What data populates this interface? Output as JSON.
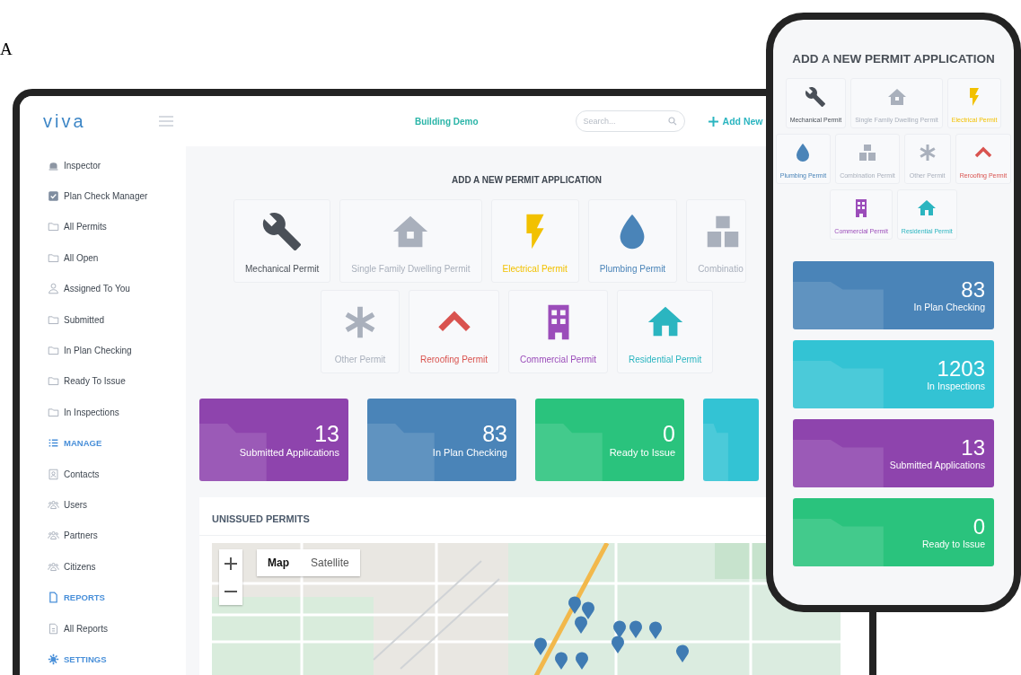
{
  "caption": "A",
  "tablet": {
    "logo": "viva",
    "header_title": "Building Demo",
    "search": {
      "placeholder": "Search..."
    },
    "add_button": "Add New",
    "sidebar": [
      {
        "kind": "inspector",
        "label": "Inspector"
      },
      {
        "kind": "check",
        "label": "Plan Check Manager"
      },
      {
        "kind": "folder",
        "label": "All Permits"
      },
      {
        "kind": "folder",
        "label": "All Open"
      },
      {
        "kind": "person",
        "label": "Assigned To You"
      },
      {
        "kind": "folder",
        "label": "Submitted"
      },
      {
        "kind": "folder",
        "label": "In Plan Checking"
      },
      {
        "kind": "folder",
        "label": "Ready To Issue"
      },
      {
        "kind": "folder",
        "label": "In Inspections"
      },
      {
        "kind": "list-heading",
        "label": "MANAGE"
      },
      {
        "kind": "contact",
        "label": "Contacts"
      },
      {
        "kind": "group",
        "label": "Users"
      },
      {
        "kind": "group",
        "label": "Partners"
      },
      {
        "kind": "group",
        "label": "Citizens"
      },
      {
        "kind": "doc-heading",
        "label": "REPORTS"
      },
      {
        "kind": "report",
        "label": "All Reports"
      },
      {
        "kind": "gear-heading",
        "label": "SETTINGS"
      }
    ],
    "permit_title": "ADD A NEW PERMIT APPLICATION",
    "permit_rows": [
      [
        {
          "kind": "mechanical",
          "label": "Mechanical Permit",
          "color": "#4a5058"
        },
        {
          "kind": "single-family",
          "label": "Single Family Dwelling Permit",
          "color": "#a9b0bc"
        },
        {
          "kind": "electrical",
          "label": "Electrical Permit",
          "color": "#f2c100"
        },
        {
          "kind": "plumbing",
          "label": "Plumbing Permit",
          "color": "#4a84b8"
        },
        {
          "kind": "combination",
          "label": "Combinatio",
          "color": "#a9b0bc"
        }
      ],
      [
        {
          "kind": "other",
          "label": "Other Permit",
          "color": "#a9b0bc"
        },
        {
          "kind": "reroofing",
          "label": "Reroofing Permit",
          "color": "#d9534f"
        },
        {
          "kind": "commercial",
          "label": "Commercial Permit",
          "color": "#9b4dba"
        },
        {
          "kind": "residential",
          "label": "Residential Permit",
          "color": "#2bb5c0"
        }
      ]
    ],
    "stats": [
      {
        "value": "13",
        "label": "Submitted Applications",
        "color": "#8e44ad"
      },
      {
        "value": "83",
        "label": "In Plan Checking",
        "color": "#4a84b8"
      },
      {
        "value": "0",
        "label": "Ready to Issue",
        "color": "#2ac37d"
      },
      {
        "color": "#33c3d4"
      }
    ],
    "unissued": {
      "title": "UNISSUED PERMITS",
      "map_types": [
        {
          "label": "Map",
          "selected": true
        },
        {
          "label": "Satellite",
          "selected": false
        }
      ]
    }
  },
  "phone": {
    "permit_title": "ADD A NEW PERMIT APPLICATION",
    "permit_rows": [
      [
        {
          "kind": "mechanical",
          "label": "Mechanical Permit",
          "color": "#4a5058"
        },
        {
          "kind": "single-family",
          "label": "Single Family Dwelling Permit",
          "color": "#a9b0bc"
        },
        {
          "kind": "electrical",
          "label": "Electrical Permit",
          "color": "#f2c100"
        }
      ],
      [
        {
          "kind": "plumbing",
          "label": "Plumbing Permit",
          "color": "#4a84b8"
        },
        {
          "kind": "combination",
          "label": "Combination Permit",
          "color": "#a9b0bc"
        },
        {
          "kind": "other",
          "label": "Other Permit",
          "color": "#a9b0bc"
        },
        {
          "kind": "reroofing",
          "label": "Reroofing Permit",
          "color": "#d9534f"
        }
      ],
      [
        {
          "kind": "commercial",
          "label": "Commercial Permit",
          "color": "#9b4dba"
        },
        {
          "kind": "residential",
          "label": "Residential Permit",
          "color": "#2bb5c0"
        }
      ]
    ],
    "stats": [
      {
        "value": "83",
        "label": "In Plan Checking",
        "color": "#4a84b8"
      },
      {
        "value": "1203",
        "label": "In Inspections",
        "color": "#33c3d4"
      },
      {
        "value": "13",
        "label": "Submitted Applications",
        "color": "#8e44ad"
      },
      {
        "value": "0",
        "label": "Ready to Issue",
        "color": "#2ac37d"
      }
    ]
  }
}
